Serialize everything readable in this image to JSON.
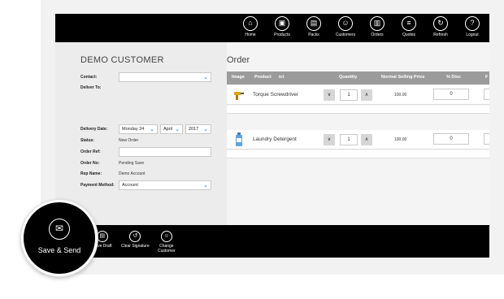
{
  "nav": [
    {
      "label": "Home",
      "icon": "home-icon",
      "glyph": "⌂"
    },
    {
      "label": "Products",
      "icon": "products-icon",
      "glyph": "▣"
    },
    {
      "label": "Packs",
      "icon": "packs-icon",
      "glyph": "▤"
    },
    {
      "label": "Customers",
      "icon": "customers-icon",
      "glyph": "☺"
    },
    {
      "label": "Orders",
      "icon": "orders-icon",
      "glyph": "▥"
    },
    {
      "label": "Quotes",
      "icon": "quotes-icon",
      "glyph": "≡"
    },
    {
      "label": "Refresh",
      "icon": "refresh-icon",
      "glyph": "↻"
    },
    {
      "label": "Logout",
      "icon": "logout-icon",
      "glyph": "?"
    }
  ],
  "customer": {
    "title": "DEMO CUSTOMER",
    "contact_label": "Contact:",
    "deliver_to_label": "Deliver To:",
    "delivery_date_label": "Delivery Date:",
    "delivery_day": "Monday 24",
    "delivery_month": "April",
    "delivery_year": "2017",
    "status_label": "Status:",
    "status_value": "New Order",
    "order_ref_label": "Order Ref:",
    "order_no_label": "Order No:",
    "order_no_value": "Pending Save",
    "rep_name_label": "Rep Name:",
    "rep_name_value": "Demo Account",
    "payment_method_label": "Payment Method:",
    "payment_method_value": "Account"
  },
  "order": {
    "title": "Order",
    "columns": {
      "image": "Image",
      "product": "Product",
      "product_overlap": "ict",
      "quantity": "Quantity",
      "price": "Normal Selling Price",
      "disc": "% Disc",
      "next": "F"
    },
    "rows": [
      {
        "name": "Torque Screwdriver",
        "qty": "1",
        "price": "100.00",
        "disc": "0",
        "icon": "screwdriver-icon"
      },
      {
        "name": "Laundry Detergent",
        "qty": "1",
        "price": "100.00",
        "disc": "0",
        "icon": "detergent-icon"
      }
    ],
    "decrement": "∨",
    "increment": "∧"
  },
  "bottom": {
    "save_draft": "Save Draft",
    "clear_signature": "Clear Signature",
    "change_customer_1": "Change",
    "change_customer_2": "Customer"
  },
  "save_send": {
    "label": "Save & Send"
  },
  "chev": "⌄"
}
